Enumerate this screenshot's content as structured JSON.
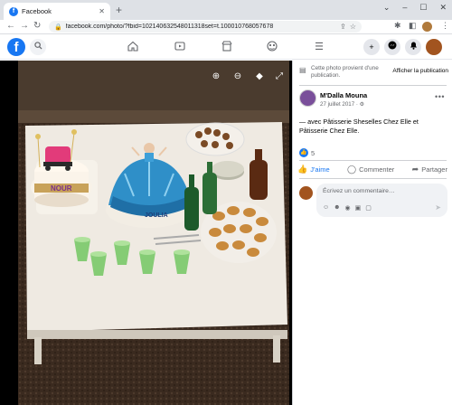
{
  "browser": {
    "tab_title": "Facebook",
    "tab_favicon": "f",
    "url": "facebook.com/photo/?fbid=102140632548011318set=t.100010768057678"
  },
  "header": {
    "logo": "f"
  },
  "photo_viewer": {
    "tags": [
      "JOULIA",
      "NOUR"
    ]
  },
  "panel": {
    "notice_text": "Cette photo provient d'une publication.",
    "notice_button": "Afficher la publication",
    "author": "M'Dalla Mouna",
    "date": "27 juillet 2017 · ⚙",
    "caption": "— avec Pâtisserie Sheselles Chez Elle et Pâtisserie Chez Elle.",
    "reaction_count": "5",
    "actions": {
      "like": "J'aime",
      "comment": "Commenter",
      "share": "Partager"
    },
    "comment_placeholder": "Écrivez un commentaire…"
  },
  "colors": {
    "brand": "#1877f2",
    "text_secondary": "#65676b"
  }
}
